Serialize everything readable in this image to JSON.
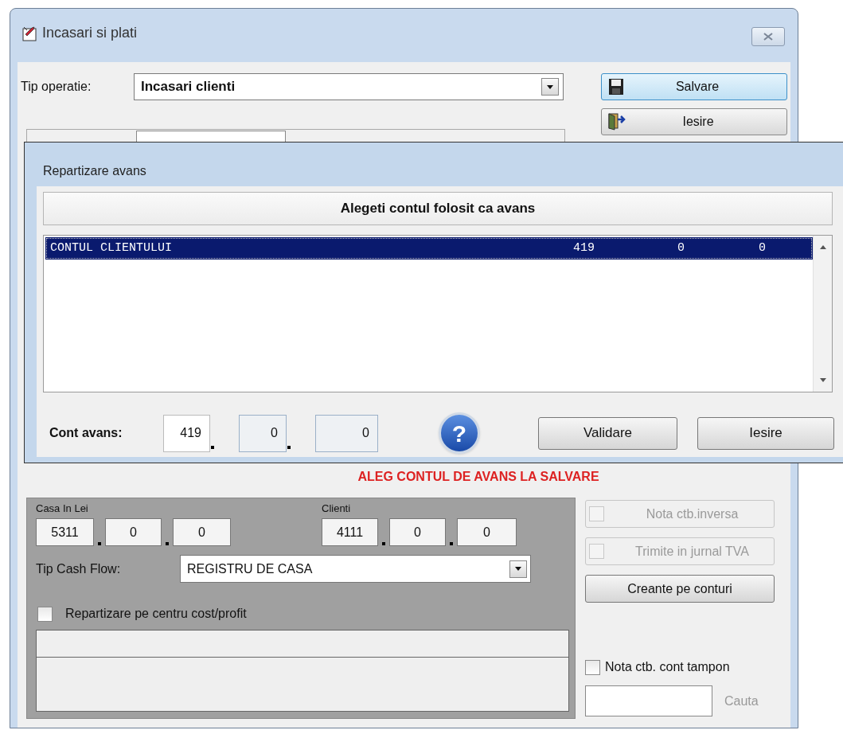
{
  "window": {
    "title": "Incasari si plati"
  },
  "operation_type": {
    "label": "Tip operatie:",
    "value": "Incasari clienti"
  },
  "buttons": [
    {
      "kind": "save",
      "label": "Salvare"
    },
    {
      "kind": "exit",
      "label": "Iesire"
    }
  ],
  "dialog": {
    "title": "Repartizare avans",
    "header": "Alegeti contul folosit ca avans",
    "rows": [
      {
        "cells": [
          "CONTUL CLIENTULUI",
          "419",
          "0",
          "0"
        ],
        "selected": true
      }
    ],
    "account_label": "Cont avans:",
    "account": [
      {
        "value": "419",
        "disabled": false
      },
      {
        "value": "0",
        "disabled": true
      },
      {
        "value": "0",
        "disabled": true
      }
    ],
    "help": "?",
    "buttons": [
      "Validare",
      "Iesire"
    ]
  },
  "notice": "ALEG CONTUL DE AVANS LA SALVARE",
  "cash": {
    "label": "Casa In Lei",
    "account": [
      "5311",
      "0",
      "0"
    ]
  },
  "clients": {
    "label": "Clienti",
    "account": [
      "4111",
      "0",
      "0"
    ]
  },
  "cash_flow": {
    "label": "Tip Cash Flow:",
    "value": "REGISTRU DE CASA"
  },
  "cost_center": {
    "label": "Repartizare pe centru cost/profit",
    "checked": false
  },
  "options": [
    {
      "kind": "checkbox",
      "label": "Nota ctb.inversa",
      "checked": false,
      "disabled": true
    },
    {
      "kind": "checkbox",
      "label": "Trimite in jurnal TVA",
      "checked": false,
      "disabled": true
    },
    {
      "kind": "button",
      "label": "Creante pe conturi"
    }
  ],
  "buffer": {
    "label": "Nota ctb. cont tampon",
    "checked": false
  },
  "search": {
    "label": "Cauta"
  }
}
